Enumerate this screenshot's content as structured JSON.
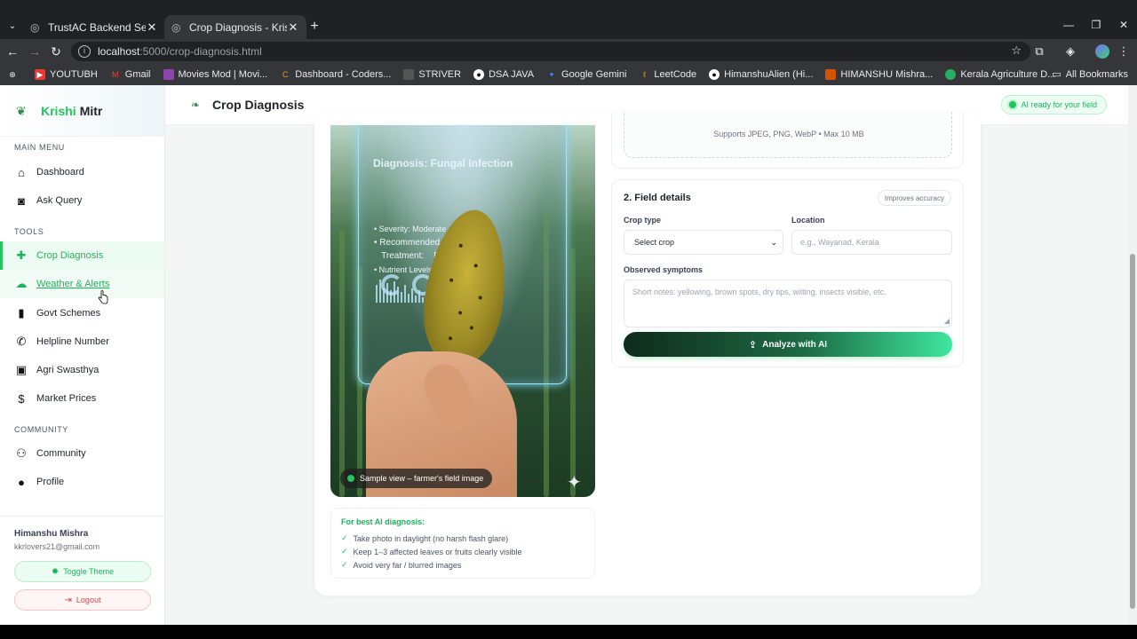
{
  "browser": {
    "tabs": [
      {
        "title": "TrustAC Backend Setup",
        "active": false
      },
      {
        "title": "Crop Diagnosis - KrishiMitr",
        "active": true
      }
    ],
    "url_host": "localhost",
    "url_path": ":5000/crop-diagnosis.html",
    "bookmarks": [
      {
        "label": "YOUTUBH",
        "icon": "youtube-icon",
        "color": "#e53935"
      },
      {
        "label": "Gmail",
        "icon": "gmail-icon",
        "color": "#ea4335"
      },
      {
        "label": "Movies Mod | Movi...",
        "icon": "bookmark-icon",
        "color": "#8e44ad"
      },
      {
        "label": "Dashboard - Coders...",
        "icon": "bookmark-icon",
        "color": "#f39c12"
      },
      {
        "label": "STRIVER",
        "icon": "bookmark-icon",
        "color": "#555555"
      },
      {
        "label": "DSA JAVA",
        "icon": "github-icon",
        "color": "#ffffff"
      },
      {
        "label": "Google Gemini",
        "icon": "gemini-icon",
        "color": "#4285f4"
      },
      {
        "label": "LeetCode",
        "icon": "leetcode-icon",
        "color": "#f89f1b"
      },
      {
        "label": "HimanshuAlien (Hi...",
        "icon": "github-icon",
        "color": "#ffffff"
      },
      {
        "label": "HIMANSHU Mishra...",
        "icon": "bookmark-icon",
        "color": "#d35400"
      },
      {
        "label": "Kerala Agriculture D...",
        "icon": "bookmark-icon",
        "color": "#27ae60"
      }
    ],
    "all_bookmarks": "All Bookmarks"
  },
  "sidebar": {
    "brand_a": "Krishi",
    "brand_b": "Mitr",
    "main_menu_label": "MAIN MENU",
    "main_items": [
      {
        "label": "Dashboard",
        "icon": "home-icon"
      },
      {
        "label": "Ask Query",
        "icon": "robot-icon"
      }
    ],
    "tools_label": "TOOLS",
    "tool_items": [
      {
        "label": "Crop Diagnosis",
        "icon": "medkit-icon",
        "state": "active"
      },
      {
        "label": "Weather & Alerts",
        "icon": "cloud-sun-icon",
        "state": "hover"
      },
      {
        "label": "Govt Schemes",
        "icon": "building-icon",
        "state": ""
      },
      {
        "label": "Helpline Number",
        "icon": "phone-icon",
        "state": ""
      },
      {
        "label": "Agri Swasthya",
        "icon": "briefcase-medical-icon",
        "state": ""
      },
      {
        "label": "Market Prices",
        "icon": "dollar-icon",
        "state": ""
      }
    ],
    "community_label": "COMMUNITY",
    "community_items": [
      {
        "label": "Community",
        "icon": "users-icon"
      },
      {
        "label": "Profile",
        "icon": "user-icon"
      }
    ],
    "user_name": "Himanshu Mishra",
    "user_email": "kkrlovers21@gmail.com",
    "toggle_theme": "Toggle Theme",
    "logout": "Logout"
  },
  "header": {
    "title": "Crop Diagnosis",
    "badge": "AI ready for your field"
  },
  "photo": {
    "hud_title": "Diagnosis: Fungal Infection",
    "hud_lines": [
      "• Severity: Moderate",
      "• Recommended",
      "   Treatment:    Fungicide X",
      "• Nutrient Levels: Optimal"
    ],
    "tag": "Sample view – farmer's field image"
  },
  "tips": {
    "title": "For best AI diagnosis:",
    "items": [
      "Take photo in daylight (no harsh flash glare)",
      "Keep 1–3 affected leaves or fruits clearly visible",
      "Avoid very far / blurred images"
    ]
  },
  "upload": {
    "hint": "Supports JPEG, PNG, WebP • Max 10 MB"
  },
  "fields": {
    "title": "2. Field details",
    "badge": "Improves accuracy",
    "crop_label": "Crop type",
    "crop_value": "Select crop",
    "location_label": "Location",
    "location_placeholder": "e.g., Wayanad, Kerala",
    "symptoms_label": "Observed symptoms",
    "symptoms_placeholder": "Short notes: yellowing, brown spots, dry tips, wilting, insects visible, etc.",
    "analyze_label": "Analyze with AI"
  }
}
